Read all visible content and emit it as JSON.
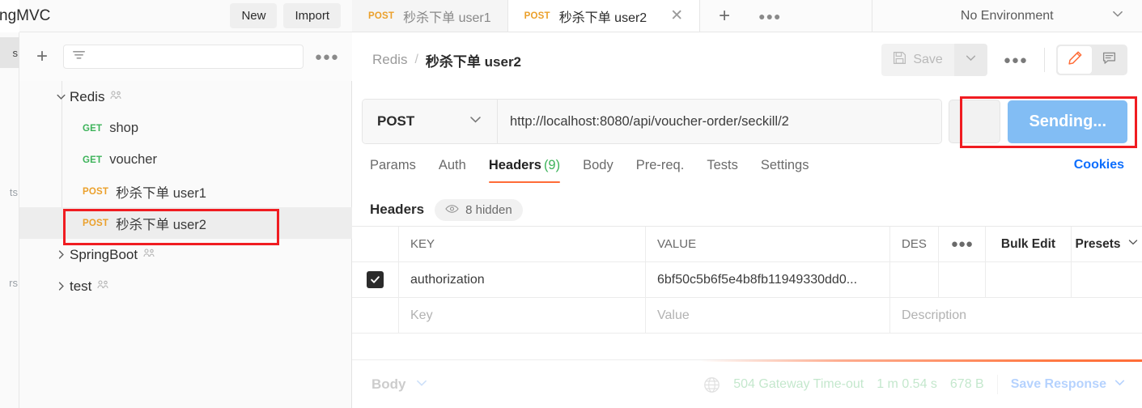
{
  "workspace": {
    "title": "ngMVC",
    "new_label": "New",
    "import_label": "Import"
  },
  "edge_nav": {
    "items": [
      {
        "label": "s",
        "full": "Collections",
        "active": true
      },
      {
        "label": "ts",
        "full": "Environments",
        "active": false
      },
      {
        "label": "rs",
        "full": "Mock Servers",
        "active": false
      }
    ]
  },
  "sidebar": {
    "add_icon": "plus-icon",
    "filter_icon": "filter-icon",
    "more_icon": "more-horizontal-icon",
    "tree": [
      {
        "type": "folder",
        "name": "Redis",
        "expanded": true,
        "shared": true,
        "selected": false
      },
      {
        "type": "request",
        "method": "GET",
        "name": "shop",
        "selected": false
      },
      {
        "type": "request",
        "method": "GET",
        "name": "voucher",
        "selected": false
      },
      {
        "type": "request",
        "method": "POST",
        "name": "秒杀下单 user1",
        "selected": false
      },
      {
        "type": "request",
        "method": "POST",
        "name": "秒杀下单 user2",
        "selected": true
      },
      {
        "type": "folder",
        "name": "SpringBoot",
        "expanded": false,
        "shared": true,
        "selected": false
      },
      {
        "type": "folder",
        "name": "test",
        "expanded": false,
        "shared": true,
        "selected": false
      }
    ]
  },
  "tabstrip": {
    "tabs": [
      {
        "method": "POST",
        "label": "秒杀下单 user1",
        "active": false,
        "closable": false
      },
      {
        "method": "POST",
        "label": "秒杀下单 user2",
        "active": true,
        "closable": true
      }
    ],
    "new_tab_icon": "plus-icon",
    "more_icon": "more-horizontal-icon",
    "environment": "No Environment"
  },
  "breadcrumb": {
    "collection": "Redis",
    "separator": "/",
    "current": "秒杀下单 user2"
  },
  "actions": {
    "save_label": "Save",
    "save_icon": "floppy-disk-icon",
    "save_caret_icon": "chevron-down-icon",
    "more_icon": "more-horizontal-icon",
    "edit_icon": "pencil-icon",
    "comment_icon": "comment-icon"
  },
  "request": {
    "method": "POST",
    "url": "http://localhost:8080/api/voucher-order/seckill/2",
    "send_label": "Sending...",
    "send_state": "sending"
  },
  "request_tabs": {
    "items": [
      {
        "label": "Params",
        "count": "",
        "active": false
      },
      {
        "label": "Auth",
        "count": "",
        "active": false
      },
      {
        "label": "Headers",
        "count": "(9)",
        "active": true
      },
      {
        "label": "Body",
        "count": "",
        "active": false
      },
      {
        "label": "Pre-req.",
        "count": "",
        "active": false
      },
      {
        "label": "Tests",
        "count": "",
        "active": false
      },
      {
        "label": "Settings",
        "count": "",
        "active": false
      }
    ],
    "cookies_label": "Cookies"
  },
  "headers_section": {
    "title": "Headers",
    "hidden_label": "8 hidden",
    "eye_icon": "eye-icon",
    "columns": {
      "key": "KEY",
      "value": "VALUE",
      "description": "DES"
    },
    "more_icon": "more-horizontal-icon",
    "bulk_edit_label": "Bulk Edit",
    "presets_label": "Presets",
    "presets_caret_icon": "chevron-down-icon",
    "rows": [
      {
        "checked": true,
        "key": "authorization",
        "value": "6bf50c5b6f5e4b8fb11949330dd0...",
        "description": ""
      },
      {
        "checked": false,
        "key": "",
        "value": "",
        "description": "",
        "key_placeholder": "Key",
        "value_placeholder": "Value",
        "description_placeholder": "Description"
      }
    ]
  },
  "response": {
    "body_label": "Body",
    "body_caret_icon": "chevron-down-icon",
    "globe_icon": "globe-icon",
    "status": "504 Gateway Time-out",
    "time": "1 m 0.54 s",
    "size": "678 B",
    "save_response_label": "Save Response",
    "save_response_caret_icon": "chevron-down-icon"
  },
  "annotations": {
    "highlight_color": "#f01c21",
    "boxes": [
      {
        "name": "sidebar-selected-request-highlight"
      },
      {
        "name": "send-button-highlight"
      }
    ]
  }
}
